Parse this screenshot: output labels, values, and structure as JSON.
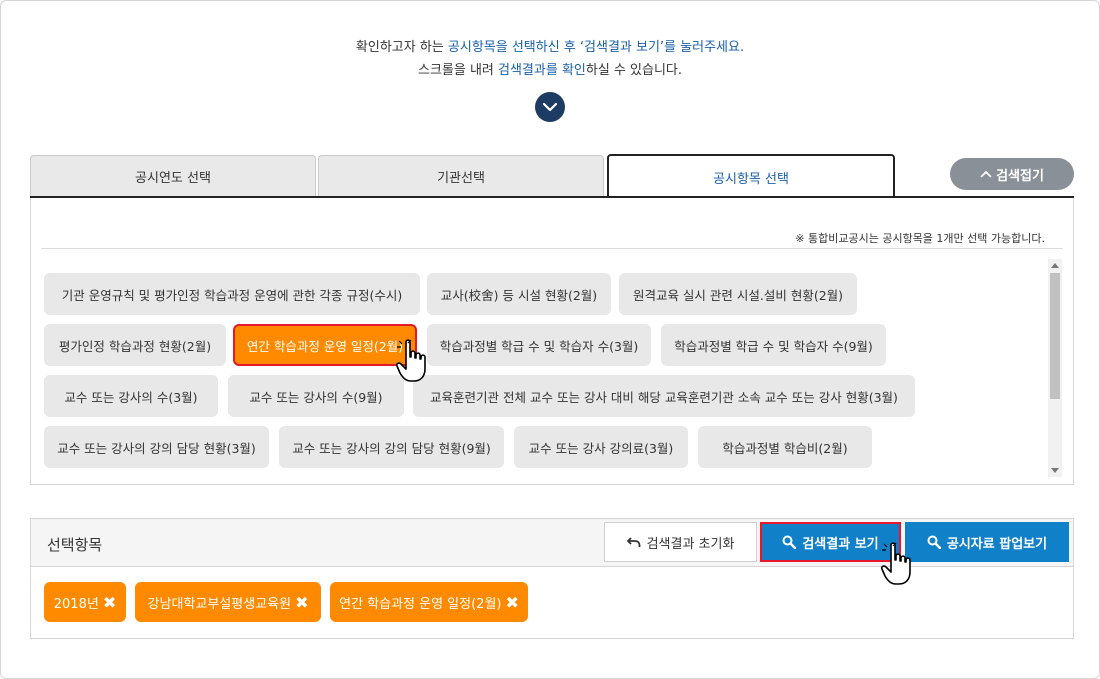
{
  "intro": {
    "line1_pre": "확인하고자 하는 ",
    "line1_hl": "공시항목을 선택하신 후 ‘검색결과 보기’를 눌러주세요.",
    "line2_pre": "스크롤을 내려 ",
    "line2_hl": "검색결과를 확인",
    "line2_post": "하실 수 있습니다."
  },
  "tabs": [
    {
      "label": "공시연도 선택"
    },
    {
      "label": "기관선택"
    },
    {
      "label": "공시항목 선택"
    }
  ],
  "collapse_label": "검색접기",
  "note": "※ 통합비교공시는 공시항목을 1개만 선택 가능합니다.",
  "items": [
    {
      "label": "기관 운영규칙 및 평가인정 학습과정 운영에 관한 각종 규정(수시)"
    },
    {
      "label": "교사(校舍) 등 시설 현황(2월)"
    },
    {
      "label": "원격교육 실시 관련 시설.설비 현황(2월)"
    },
    {
      "label": "평가인정 학습과정 현황(2월)"
    },
    {
      "label": "연간 학습과정 운영 일정(2월)"
    },
    {
      "label": "학습과정별 학급 수 및 학습자 수(3월)"
    },
    {
      "label": "학습과정별 학급 수 및 학습자 수(9월)"
    },
    {
      "label": "교수 또는 강사의 수(3월)"
    },
    {
      "label": "교수 또는 강사의 수(9월)"
    },
    {
      "label": "교육훈련기관 전체 교수 또는 강사 대비 해당 교육훈련기관 소속 교수 또는 강사 현황(3월)"
    },
    {
      "label": "교수 또는 강사의 강의 담당 현황(3월)"
    },
    {
      "label": "교수 또는 강사의 강의 담당 현황(9월)"
    },
    {
      "label": "교수 또는 강사 강의료(3월)"
    },
    {
      "label": "학습과정별 학습비(2월)"
    }
  ],
  "selection": {
    "title": "선택항목",
    "reset_label": "검색결과 초기화",
    "search_label": "검색결과 보기",
    "popup_label": "공시자료 팝업보기",
    "chips": [
      {
        "label": "2018년"
      },
      {
        "label": "강남대학교부설평생교육원"
      },
      {
        "label": "연간 학습과정 운영 일정(2월)"
      }
    ]
  },
  "icons": {
    "scroll": "chevron-down-icon",
    "collapse": "chevron-up-icon",
    "reset": "undo-icon",
    "search": "search-icon",
    "remove": "close-icon",
    "cursor": "hand-pointer-icon"
  },
  "colors": {
    "accent_blue": "#1080c8",
    "selected_orange": "#ff8a00",
    "highlight_red": "#e8182c",
    "navy": "#1d3c63"
  }
}
